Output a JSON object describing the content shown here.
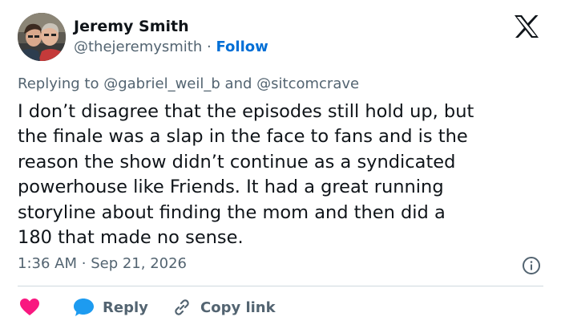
{
  "author": {
    "name": "Jeremy Smith",
    "handle": "@thejeremysmith",
    "separator": "·",
    "follow_label": "Follow"
  },
  "reply_context": {
    "prefix": "Replying to",
    "mention_1": "@gabriel_weil_b",
    "conjunction": "and",
    "mention_2": "@sitcomcrave"
  },
  "tweet": {
    "text": "I don’t disagree that the episodes still hold up, but\nthe finale was a slap in the face to fans and is the\nreason the show didn’t continue as a syndicated\npowerhouse like Friends.  It had a great running\nstoryline about finding the mom and then did a\n180 that made no sense.",
    "time": "1:36 AM",
    "date_separator": "·",
    "date": "Sep 21, 2026"
  },
  "actions": {
    "like_icon": "heart-icon",
    "reply_label": "Reply",
    "copy_link_label": "Copy link"
  },
  "icons": {
    "logo": "x-logo-icon",
    "info": "info-icon",
    "reply": "speech-bubble-icon",
    "link": "link-icon"
  },
  "colors": {
    "text_primary": "#0f1419",
    "text_secondary": "#536471",
    "follow_blue": "#006fd6",
    "like_pink": "#f91880",
    "reply_blue": "#1d9bf0",
    "divider": "#cfd9de"
  }
}
